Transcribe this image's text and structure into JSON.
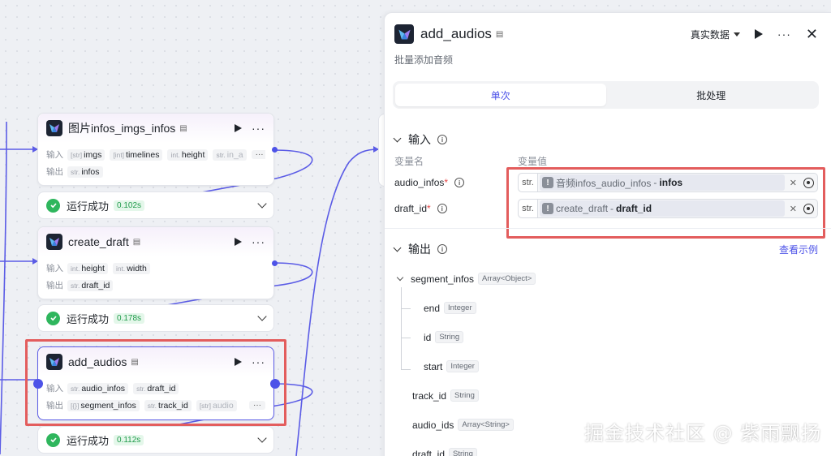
{
  "nodes": [
    {
      "title": "图片infos_imgs_infos",
      "input_label": "输入",
      "output_label": "输出",
      "inputs": [
        {
          "type": "[str]",
          "name": "imgs"
        },
        {
          "type": "[int]",
          "name": "timelines"
        },
        {
          "type": "int.",
          "name": "height"
        },
        {
          "type": "str.",
          "name": "in_a"
        }
      ],
      "outputs": [
        {
          "type": "str.",
          "name": "infos"
        }
      ],
      "more": "···"
    },
    {
      "title": "create_draft",
      "input_label": "输入",
      "output_label": "输出",
      "inputs": [
        {
          "type": "int.",
          "name": "height"
        },
        {
          "type": "int.",
          "name": "width"
        }
      ],
      "outputs": [
        {
          "type": "str.",
          "name": "draft_id"
        }
      ]
    },
    {
      "title": "add_audios",
      "input_label": "输入",
      "output_label": "输出",
      "inputs": [
        {
          "type": "str.",
          "name": "audio_infos"
        },
        {
          "type": "str.",
          "name": "draft_id"
        }
      ],
      "outputs": [
        {
          "type": "[{}]",
          "name": "segment_infos"
        },
        {
          "type": "str.",
          "name": "track_id"
        },
        {
          "type": "[str]",
          "name": "audio"
        }
      ],
      "more": "···"
    }
  ],
  "statuses": [
    {
      "text": "运行成功",
      "time": "0.102s"
    },
    {
      "text": "运行成功",
      "time": "0.178s"
    },
    {
      "text": "运行成功",
      "time": "0.112s"
    }
  ],
  "panel": {
    "title": "add_audios",
    "subtitle": "批量添加音频",
    "mode": "真实数据",
    "tabs": [
      "单次",
      "批处理"
    ],
    "input_section": "输入",
    "col_name": "变量名",
    "col_value": "变量值",
    "variables": [
      {
        "name": "audio_infos",
        "required": "*",
        "type": "str.",
        "source": "音频infos_audio_infos",
        "sep": "-",
        "field": "infos"
      },
      {
        "name": "draft_id",
        "required": "*",
        "type": "str.",
        "source": "create_draft",
        "sep": "-",
        "field": "draft_id"
      }
    ],
    "output_section": "输出",
    "example_link": "查看示例",
    "outputs": [
      {
        "name": "segment_infos",
        "type": "Array<Object>"
      },
      {
        "name": "end",
        "type": "Integer"
      },
      {
        "name": "id",
        "type": "String"
      },
      {
        "name": "start",
        "type": "Integer"
      },
      {
        "name": "track_id",
        "type": "String"
      },
      {
        "name": "audio_ids",
        "type": "Array<String>"
      },
      {
        "name": "draft_id",
        "type": "String"
      }
    ]
  },
  "watermark": "掘金技术社区 @ 紫雨飘扬",
  "colors": {
    "accent": "#4d53e8",
    "highlight": "#e35d5d",
    "success": "#2fb65d"
  }
}
